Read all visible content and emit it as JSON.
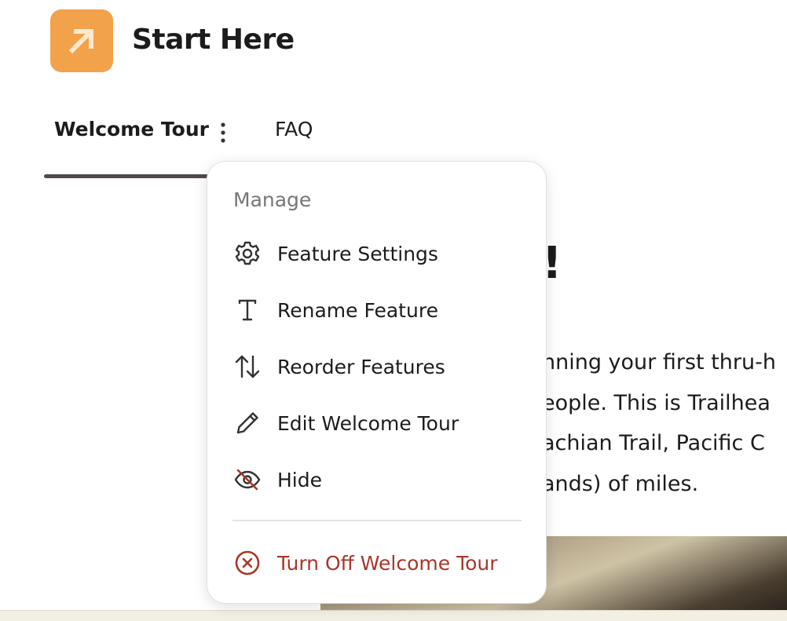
{
  "app": {
    "title": "Start Here",
    "icon": "arrow-up-right-icon",
    "accent_color": "#f2a24a"
  },
  "tabs": [
    {
      "label": "Welcome Tour",
      "active": true
    },
    {
      "label": "FAQ",
      "active": false
    }
  ],
  "content": {
    "heading_fragment": "!",
    "body_lines": [
      "nning your first thru-h",
      "eople. This is Trailhea",
      "achian Trail, Pacific C",
      "ands) of miles."
    ]
  },
  "menu": {
    "header": "Manage",
    "items": [
      {
        "label": "Feature Settings",
        "icon": "gear-icon"
      },
      {
        "label": "Rename Feature",
        "icon": "text-icon"
      },
      {
        "label": "Reorder Features",
        "icon": "reorder-icon"
      },
      {
        "label": "Edit Welcome Tour",
        "icon": "pencil-icon"
      },
      {
        "label": "Hide",
        "icon": "eye-off-icon"
      }
    ],
    "danger_item": {
      "label": "Turn Off Welcome Tour",
      "icon": "circle-x-icon",
      "color": "#a8362a"
    }
  }
}
